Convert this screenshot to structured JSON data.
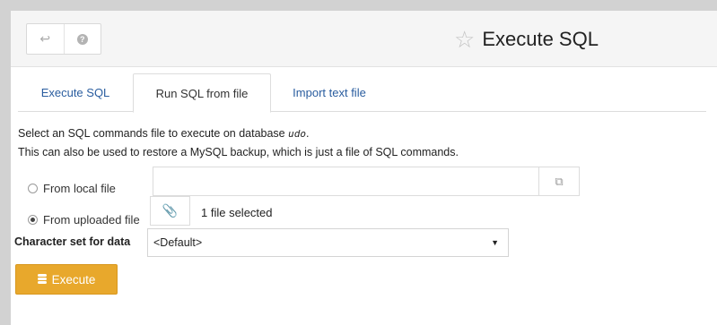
{
  "header": {
    "back_icon": "back-arrow-icon",
    "help_icon": "help-icon",
    "title_icon": "star-outline-icon",
    "title": "Execute SQL"
  },
  "tabs": [
    {
      "label": "Execute SQL",
      "active": false
    },
    {
      "label": "Run SQL from file",
      "active": true
    },
    {
      "label": "Import text file",
      "active": false
    }
  ],
  "description": {
    "line1_prefix": "Select an SQL commands file to execute on database",
    "database": "udo",
    "line1_suffix": ".",
    "line2": "This can also be used to restore a MySQL backup, which is just a file of SQL commands."
  },
  "source": {
    "local_label": "From local file",
    "local_selected": false,
    "local_value": "",
    "uploaded_label": "From uploaded file",
    "uploaded_selected": true,
    "uploaded_status": "1 file selected"
  },
  "charset": {
    "label": "Character set for data",
    "selected": "<Default>"
  },
  "execute_button": {
    "label": "Execute",
    "icon": "database-icon",
    "color": "#e8a82c"
  },
  "colors": {
    "link": "#2a5d9f",
    "background": "#d2d2d2"
  }
}
